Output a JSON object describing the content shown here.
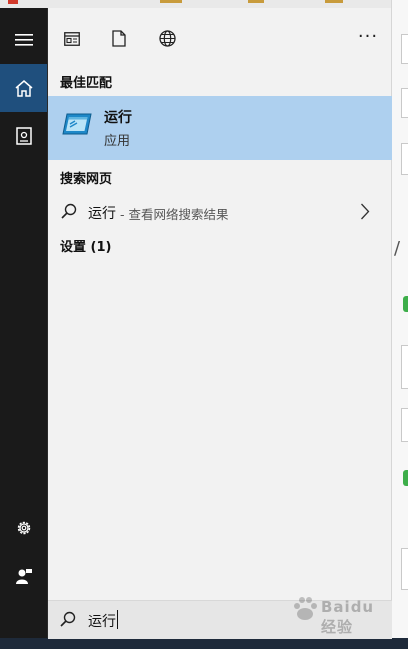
{
  "toolbar": {
    "icons": [
      "app-window-icon",
      "document-icon",
      "globe-icon"
    ],
    "more_label": "···"
  },
  "rail": {
    "icons": [
      "hamburger-icon",
      "home-icon",
      "notebook-icon",
      "gear-icon",
      "user-feedback-icon"
    ]
  },
  "sections": {
    "best_match": "最佳匹配",
    "search_web": "搜索网页",
    "settings": "设置 (1)"
  },
  "best_match": {
    "title": "运行",
    "subtitle": "应用",
    "icon": "run-app-icon"
  },
  "web_result": {
    "term": "运行",
    "hint": "- 查看网络搜索结果"
  },
  "search": {
    "query": "运行"
  },
  "watermark": {
    "text": "Baidu经验"
  },
  "colors": {
    "rail_bg": "#1a1a1a",
    "rail_active": "#1f4f7d",
    "panel_bg": "#f2f2f2",
    "highlight": "#aed0ef"
  }
}
